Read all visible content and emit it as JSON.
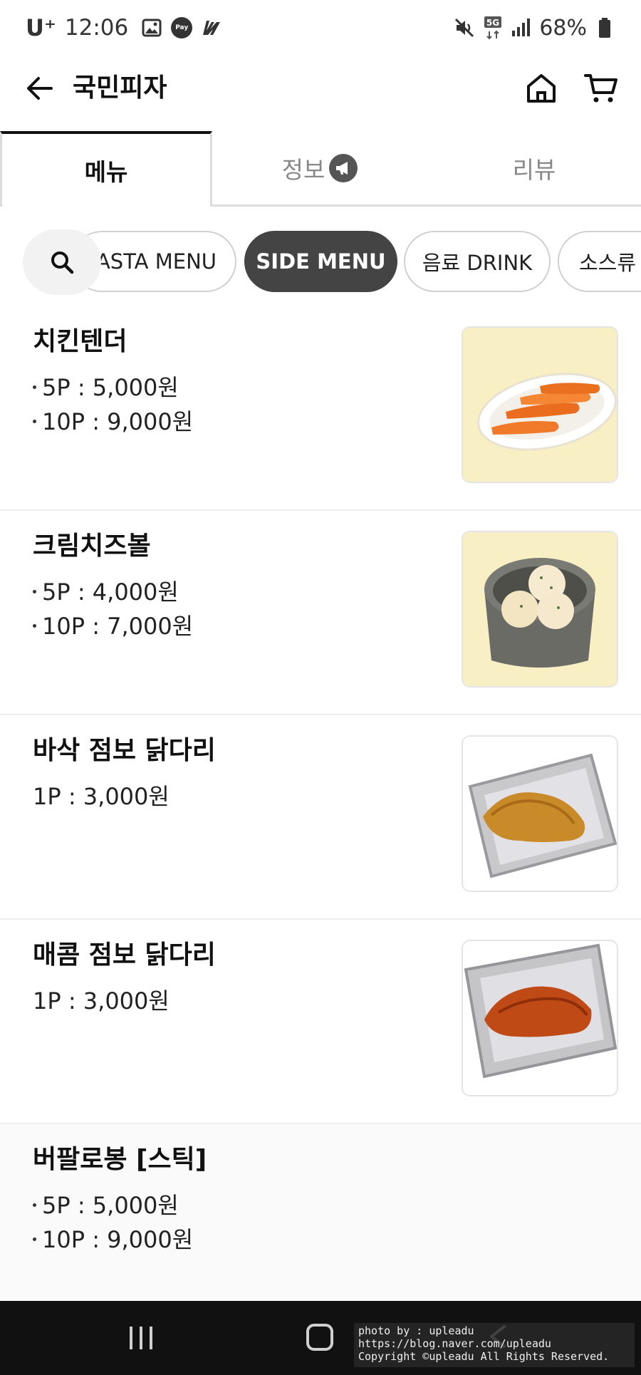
{
  "status_bar": {
    "carrier": "U⁺",
    "time": "12:06",
    "pay_label": "Pay",
    "network": "5G",
    "battery": "68%"
  },
  "app_bar": {
    "title": "국민피자"
  },
  "tabs": [
    {
      "label": "메뉴",
      "selected": true
    },
    {
      "label": "정보",
      "selected": false
    },
    {
      "label": "리뷰",
      "selected": false
    }
  ],
  "categories": [
    {
      "label": "ASTA MENU",
      "selected": false
    },
    {
      "label": "SIDE MENU",
      "selected": true
    },
    {
      "label": "음료 DRINK",
      "selected": false
    },
    {
      "label": "소스류",
      "selected": false
    }
  ],
  "menu_items": [
    {
      "name": "치킨텐더",
      "prices": [
        "5P : 5,000원",
        "10P : 9,000원"
      ],
      "photo": "chicken-tenders"
    },
    {
      "name": "크림치즈볼",
      "prices": [
        "5P : 4,000원",
        "10P : 7,000원"
      ],
      "photo": "cream-cheese-balls"
    },
    {
      "name": "바삭 점보 닭다리",
      "price_single": "1P : 3,000원",
      "photo": "crispy-drumstick"
    },
    {
      "name": "매콤 점보 닭다리",
      "price_single": "1P : 3,000원",
      "photo": "spicy-drumstick"
    },
    {
      "name": "버팔로봉 [스틱]",
      "prices": [
        "5P : 5,000원",
        "10P : 9,000원"
      ]
    }
  ],
  "watermark": {
    "line1": "photo by : upleadu",
    "line2": "https://blog.naver.com/upleadu",
    "line3": "Copyright ©upleadu All Rights Reserved."
  },
  "colors": {
    "accent_dark": "#444444",
    "tab_indicator": "#111111",
    "photo_bg_cream": "#f8efc4"
  }
}
